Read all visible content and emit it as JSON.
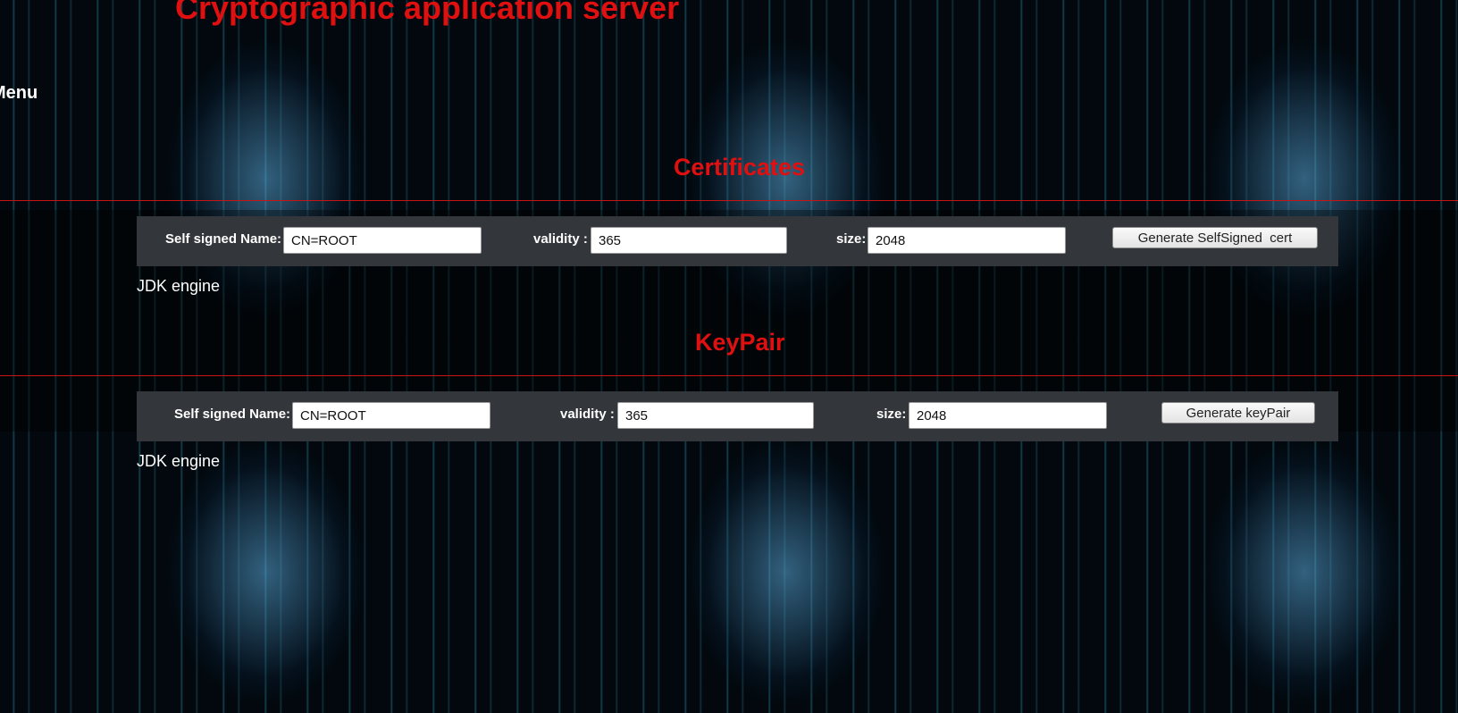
{
  "app": {
    "title": "Cryptographic application server",
    "menu_label": "Menu"
  },
  "certificates": {
    "heading": "Certificates",
    "name_label": "Self signed Name:",
    "name_value": "CN=ROOT",
    "validity_label": "validity :",
    "validity_value": "365",
    "size_label": "size:",
    "size_value": "2048",
    "button_label": "Generate SelfSigned  cert",
    "engine_note": "JDK engine"
  },
  "keypair": {
    "heading": "KeyPair",
    "name_label": "Self signed Name:",
    "name_value": "CN=ROOT",
    "validity_label": "validity :",
    "validity_value": "365",
    "size_label": "size:",
    "size_value": "2048",
    "button_label": "Generate keyPair",
    "engine_note": "JDK engine"
  },
  "colors": {
    "accent_red": "#e01010",
    "rule_red": "#c81414",
    "panel_bg": "#33363b",
    "background": "#02080d",
    "matrix_cyan": "#3cbedc"
  },
  "background_image": "skull-matrix-pattern"
}
